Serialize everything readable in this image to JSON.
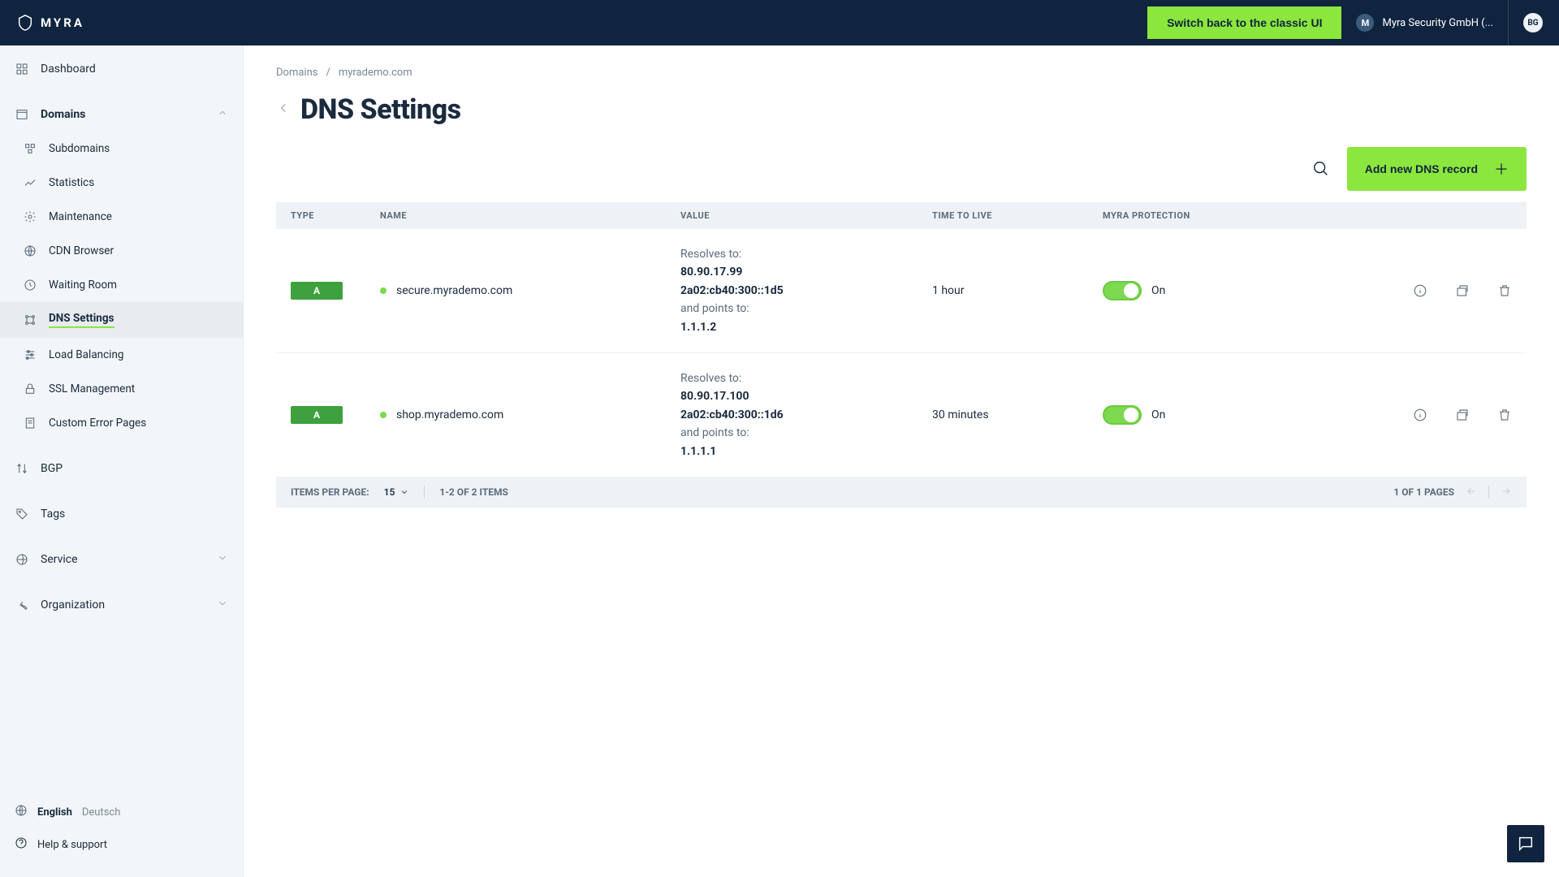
{
  "header": {
    "brand": "MYRA",
    "switch_classic": "Switch back to the classic UI",
    "org_name": "Myra Security GmbH (...",
    "org_initial": "M",
    "user_initials": "BG"
  },
  "sidebar": {
    "dashboard": "Dashboard",
    "domains": "Domains",
    "domain_children": [
      "Subdomains",
      "Statistics",
      "Maintenance",
      "CDN Browser",
      "Waiting Room",
      "DNS Settings",
      "Load Balancing",
      "SSL Management",
      "Custom Error Pages"
    ],
    "bgp": "BGP",
    "tags": "Tags",
    "service": "Service",
    "organization": "Organization",
    "lang_en": "English",
    "lang_de": "Deutsch",
    "help": "Help & support"
  },
  "breadcrumb": {
    "root": "Domains",
    "current": "myrademo.com"
  },
  "page": {
    "title": "DNS Settings",
    "add_button": "Add new DNS record"
  },
  "table": {
    "headers": {
      "type": "TYPE",
      "name": "NAME",
      "value": "VALUE",
      "ttl": "TIME TO LIVE",
      "protection": "MYRA PROTECTION"
    },
    "value_labels": {
      "resolves": "Resolves to:",
      "points": "and points to:"
    },
    "protection_on": "On",
    "rows": [
      {
        "type": "A",
        "name": "secure.myrademo.com",
        "resolves_ip4": "80.90.17.99",
        "resolves_ip6": "2a02:cb40:300::1d5",
        "points": "1.1.1.2",
        "ttl": "1 hour"
      },
      {
        "type": "A",
        "name": "shop.myrademo.com",
        "resolves_ip4": "80.90.17.100",
        "resolves_ip6": "2a02:cb40:300::1d6",
        "points": "1.1.1.1",
        "ttl": "30 minutes"
      }
    ],
    "footer": {
      "items_per_page_label": "ITEMS PER PAGE:",
      "items_per_page_value": "15",
      "range": "1-2 OF 2 ITEMS",
      "pages": "1 OF 1 PAGES"
    }
  }
}
